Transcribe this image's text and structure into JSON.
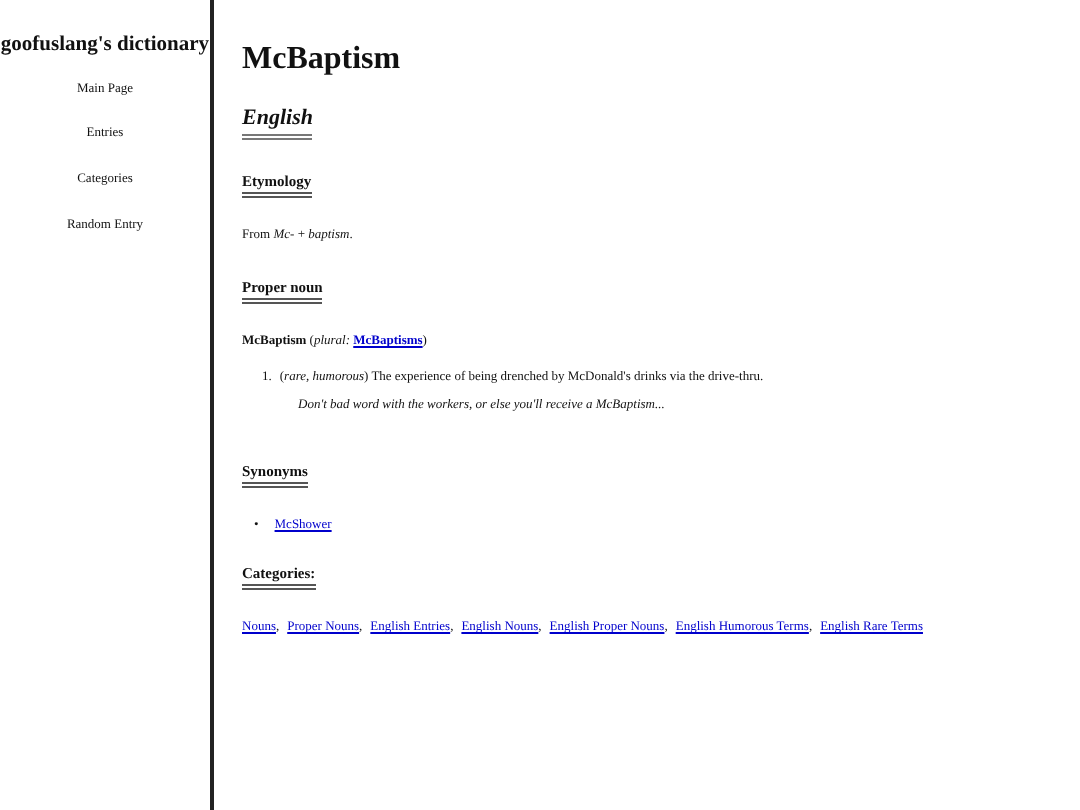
{
  "sidebar": {
    "title": "goofuslang's dictionary",
    "items": [
      {
        "label": "Main Page"
      },
      {
        "label": "Entries"
      },
      {
        "label": "Categories"
      },
      {
        "label": "Random Entry"
      }
    ]
  },
  "page_title": "McBaptism",
  "language": "English",
  "etymology": {
    "heading": "Etymology",
    "text": "From *Mc-* + *baptism*."
  },
  "proper_noun": {
    "heading": "Proper noun",
    "headword": "**McBaptism** (*plural:* ",
    "plural_link": "McBaptisms",
    "headword_end": ")",
    "definitions": [
      {
        "number": "1.",
        "text": "(*rare, humorous*) The experience of being drenched by McDonald's drinks via the drive-thru.",
        "example": "Don't bad word with the workers, or else you'll receive a McBaptism..."
      }
    ]
  },
  "synonyms": {
    "heading": "Synonyms",
    "items": [
      {
        "bullet": "•",
        "label": "McShower"
      }
    ]
  },
  "categories": {
    "heading": "Categories:",
    "separator": ",",
    "items": [
      "Nouns",
      "Proper Nouns",
      "English Entries",
      "English Nouns",
      "English Proper Nouns",
      "English Humorous Terms",
      "English Rare Terms"
    ]
  }
}
